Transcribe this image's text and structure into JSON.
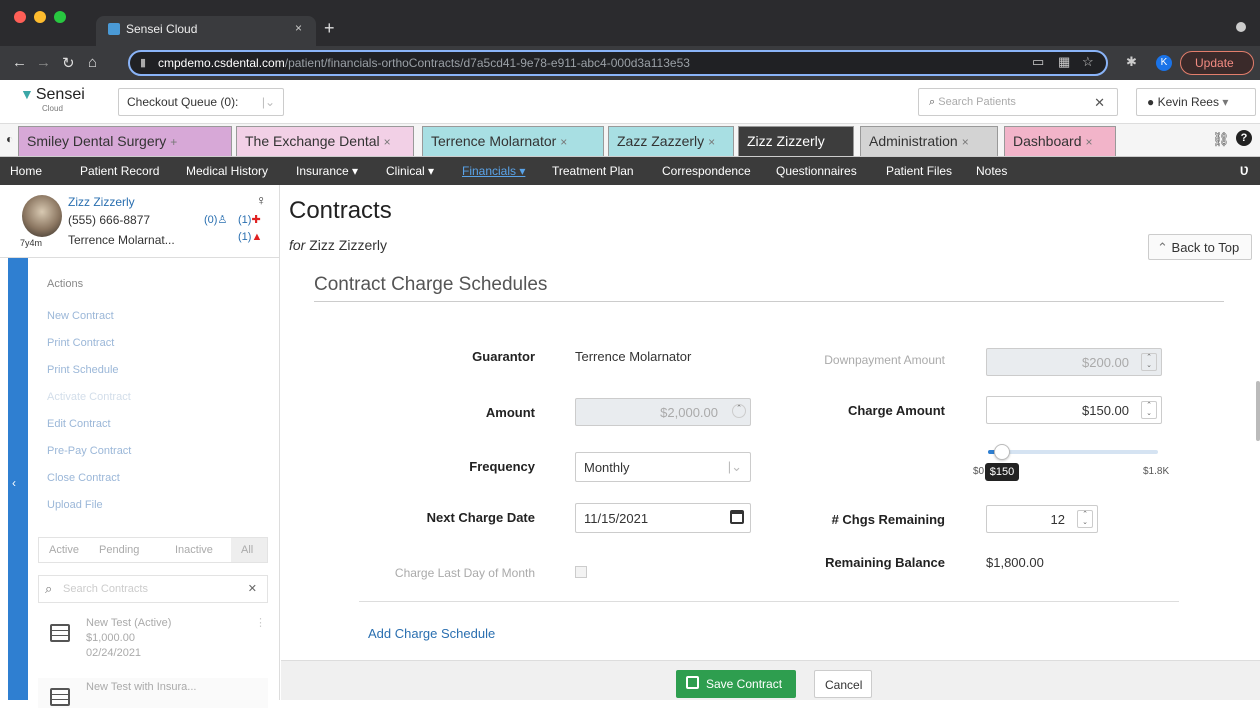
{
  "browser": {
    "tab_title": "Sensei Cloud",
    "tab_close": "×",
    "new_tab": "+",
    "url_domain": "cmpdemo.csdental.com",
    "url_path": "/patient/financials-orthoContracts/d7a5cd41-9e78-e911-abc4-000d3a113e53",
    "profile_initial": "K",
    "update_label": "Update"
  },
  "app": {
    "logo": "Sensei",
    "logo_sub": "Cloud",
    "queue_label": "Checkout Queue (0):",
    "search_placeholder": "Search Patients",
    "user_name": "Kevin Rees"
  },
  "patient_tabs": [
    {
      "label": "Smiley Dental Surgery",
      "close": "+",
      "color": "#d7a8d7"
    },
    {
      "label": "The Exchange Dental",
      "close": "×",
      "color": "#f2d0e6"
    },
    {
      "label": "Terrence Molarnator",
      "close": "×",
      "color": "#a8dfe3"
    },
    {
      "label": "Zazz Zazzerly",
      "close": "×",
      "color": "#a8dfe3"
    },
    {
      "label": "Zizz Zizzerly",
      "close": "",
      "color": "#3d3d3d"
    },
    {
      "label": "Administration",
      "close": "×",
      "color": "#d3d3d3"
    },
    {
      "label": "Dashboard",
      "close": "×",
      "color": "#f2b4c9"
    }
  ],
  "nav": [
    "Home",
    "Patient Record",
    "Medical History",
    "Insurance ▾",
    "Clinical ▾",
    "Financials ▾",
    "Treatment Plan",
    "Correspondence",
    "Questionnaires",
    "Patient Files",
    "Notes"
  ],
  "patient": {
    "name": "Zizz Zizzerly",
    "phone": "(555) 666-8877",
    "age": "7y4m",
    "guarantor": "Terrence Molarnat...",
    "count_a": "(0)",
    "count_b": "(1)",
    "count_c": "(1)"
  },
  "sidebar": {
    "heading": "Actions",
    "actions": [
      "New Contract",
      "Print Contract",
      "Print Schedule",
      "Activate Contract",
      "Edit Contract",
      "Pre-Pay Contract",
      "Close Contract",
      "Upload File"
    ],
    "filters": [
      "Active",
      "Pending",
      "Inactive",
      "All"
    ],
    "search_placeholder": "Search Contracts",
    "contracts": [
      {
        "name": "New Test (Active)",
        "amount": "$1,000.00",
        "date": "02/24/2021"
      },
      {
        "name": "New Test with Insura...",
        "amount": "",
        "date": ""
      }
    ]
  },
  "page": {
    "title": "Contracts",
    "for_prefix": "for",
    "for_name": "Zizz Zizzerly",
    "back_to_top": "Back to Top",
    "section_title": "Contract Charge Schedules"
  },
  "form": {
    "guarantor_label": "Guarantor",
    "guarantor_value": "Terrence Molarnator",
    "downpayment_label": "Downpayment Amount",
    "downpayment_value": "$200.00",
    "amount_label": "Amount",
    "amount_value": "$2,000.00",
    "charge_amount_label": "Charge Amount",
    "charge_amount_value": "$150.00",
    "frequency_label": "Frequency",
    "frequency_value": "Monthly",
    "slider_min": "$0",
    "slider_max": "$1.8K",
    "slider_tip": "$150",
    "slider_fraction": 0.083,
    "next_date_label": "Next Charge Date",
    "next_date_value": "11/15/2021",
    "chgs_remaining_label": "# Chgs Remaining",
    "chgs_remaining_value": "12",
    "remaining_balance_label": "Remaining Balance",
    "remaining_balance_value": "$1,800.00",
    "last_day_label": "Charge Last Day of Month",
    "add_schedule": "Add Charge Schedule"
  },
  "footer": {
    "save": "Save Contract",
    "cancel": "Cancel"
  }
}
